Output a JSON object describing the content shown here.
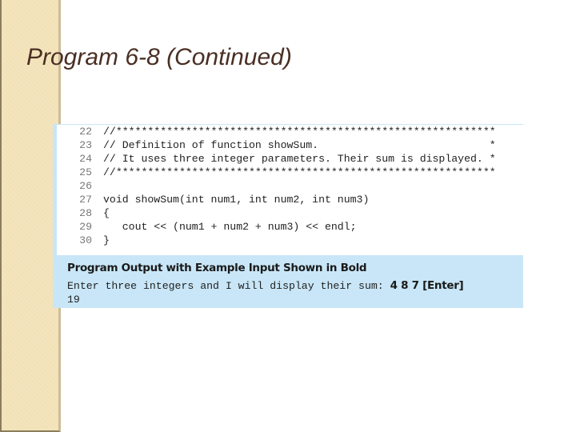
{
  "slide": {
    "title": "Program 6-8 (Continued)"
  },
  "code": {
    "lines": [
      {
        "no": "22",
        "text": "//************************************************************"
      },
      {
        "no": "23",
        "text": "// Definition of function showSum.                           *"
      },
      {
        "no": "24",
        "text": "// It uses three integer parameters. Their sum is displayed. *"
      },
      {
        "no": "25",
        "text": "//************************************************************"
      },
      {
        "no": "26",
        "text": ""
      },
      {
        "no": "27",
        "text": "void showSum(int num1, int num2, int num3)"
      },
      {
        "no": "28",
        "text": "{"
      },
      {
        "no": "29",
        "text": "   cout << (num1 + num2 + num3) << endl;"
      },
      {
        "no": "30",
        "text": "}"
      }
    ]
  },
  "output": {
    "heading": "Program Output with Example Input Shown in Bold",
    "prompt": "Enter three integers and I will display their sum: ",
    "user_input": "4 8 7 [Enter]",
    "result": "19"
  },
  "colors": {
    "sidebar": "#f2e1b6",
    "output_bg": "#c8e6f7",
    "title_text": "#4a2f24"
  }
}
